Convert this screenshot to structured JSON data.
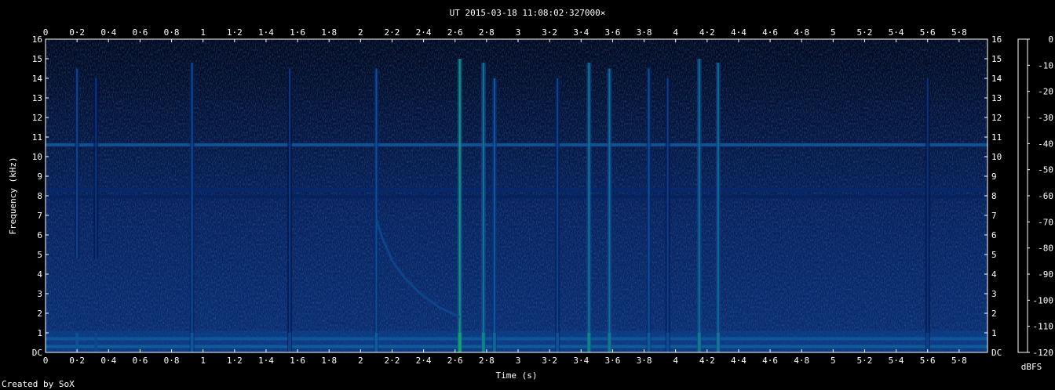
{
  "chart_data": {
    "type": "heatmap",
    "title": "UT 2015-03-18 11:08:02·327000×",
    "xlabel": "Time (s)",
    "ylabel": "Frequency (kHz)",
    "colorbar_label": "dBFS",
    "credit": "Created by SoX",
    "xlim": [
      0,
      5.98
    ],
    "ylim": [
      0,
      16
    ],
    "x_ticks": [
      "0",
      "0·2",
      "0·4",
      "0·6",
      "0·8",
      "1",
      "1·2",
      "1·4",
      "1·6",
      "1·8",
      "2",
      "2·2",
      "2·4",
      "2·6",
      "2·8",
      "3",
      "3·2",
      "3·4",
      "3·6",
      "3·8",
      "4",
      "4·2",
      "4·4",
      "4·6",
      "4·8",
      "5",
      "5·2",
      "5·4",
      "5·6",
      "5·8"
    ],
    "y_ticks": [
      "DC",
      "1",
      "2",
      "3",
      "4",
      "5",
      "6",
      "7",
      "8",
      "9",
      "10",
      "11",
      "12",
      "13",
      "14",
      "15",
      "16"
    ],
    "colorbar_ticks": [
      "0",
      "-10",
      "-20",
      "-30",
      "-40",
      "-50",
      "-60",
      "-70",
      "-80",
      "-90",
      "-100",
      "-110",
      "-120"
    ],
    "colorbar_range": [
      -120,
      0
    ],
    "colormap": [
      "#000000",
      "#00001a",
      "#001650",
      "#0a3a86",
      "#10589c",
      "#127a8e",
      "#12a070",
      "#10c844",
      "#30e030",
      "#c8f07a",
      "#ffffff"
    ],
    "background_level_dbfs": -100,
    "horizontal_lines": [
      {
        "freq_khz": 10.6,
        "level_dbfs": -72
      },
      {
        "freq_khz": 8.3,
        "level_dbfs": -90
      },
      {
        "freq_khz": 7.95,
        "level_dbfs": -92
      },
      {
        "freq_khz": 0.7,
        "level_dbfs": -72
      },
      {
        "freq_khz": 0.3,
        "level_dbfs": -70
      }
    ],
    "impulses": [
      {
        "t": 0.2,
        "fmax_khz": 14.5,
        "fmin_khz": 4.8,
        "level_dbfs": -80
      },
      {
        "t": 0.32,
        "fmax_khz": 14.0,
        "fmin_khz": 4.8,
        "level_dbfs": -85
      },
      {
        "t": 0.93,
        "fmax_khz": 14.8,
        "fmin_khz": 0,
        "level_dbfs": -78
      },
      {
        "t": 1.55,
        "fmax_khz": 14.5,
        "fmin_khz": 0,
        "level_dbfs": -85
      },
      {
        "t": 2.1,
        "fmax_khz": 14.5,
        "fmin_khz": 0,
        "level_dbfs": -76
      },
      {
        "t": 2.63,
        "fmax_khz": 15.0,
        "fmin_khz": 0,
        "level_dbfs": -52
      },
      {
        "t": 2.78,
        "fmax_khz": 14.8,
        "fmin_khz": 0,
        "level_dbfs": -62
      },
      {
        "t": 2.85,
        "fmax_khz": 14.0,
        "fmin_khz": 0,
        "level_dbfs": -72
      },
      {
        "t": 3.25,
        "fmax_khz": 14.0,
        "fmin_khz": 0,
        "level_dbfs": -80
      },
      {
        "t": 3.45,
        "fmax_khz": 14.8,
        "fmin_khz": 0,
        "level_dbfs": -62
      },
      {
        "t": 3.58,
        "fmax_khz": 14.5,
        "fmin_khz": 0,
        "level_dbfs": -65
      },
      {
        "t": 3.83,
        "fmax_khz": 14.5,
        "fmin_khz": 0,
        "level_dbfs": -76
      },
      {
        "t": 3.95,
        "fmax_khz": 14.0,
        "fmin_khz": 0,
        "level_dbfs": -82
      },
      {
        "t": 4.15,
        "fmax_khz": 15.0,
        "fmin_khz": 0,
        "level_dbfs": -65
      },
      {
        "t": 4.27,
        "fmax_khz": 14.8,
        "fmin_khz": 0,
        "level_dbfs": -66
      },
      {
        "t": 5.6,
        "fmax_khz": 14.0,
        "fmin_khz": 0,
        "level_dbfs": -86
      }
    ],
    "whistler": [
      {
        "t": 2.1,
        "f_khz": 6.8
      },
      {
        "t": 2.14,
        "f_khz": 5.8
      },
      {
        "t": 2.2,
        "f_khz": 4.7
      },
      {
        "t": 2.28,
        "f_khz": 3.8
      },
      {
        "t": 2.38,
        "f_khz": 3.0
      },
      {
        "t": 2.5,
        "f_khz": 2.3
      },
      {
        "t": 2.63,
        "f_khz": 1.8
      }
    ],
    "whistler_level_dbfs": -78
  }
}
